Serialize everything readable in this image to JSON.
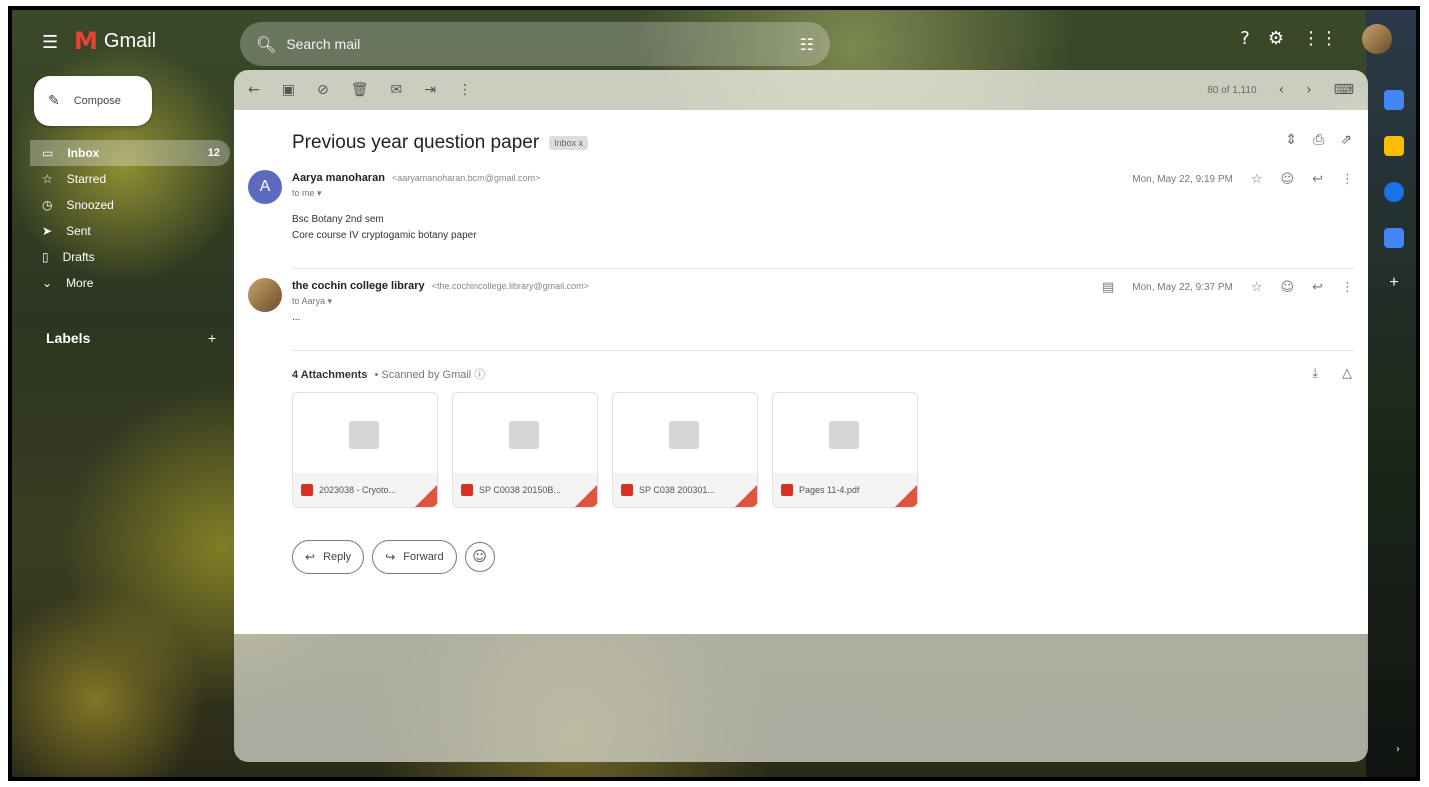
{
  "header": {
    "app_name": "Gmail",
    "search_placeholder": "Search mail"
  },
  "sidebar": {
    "compose_label": "Compose",
    "items": [
      {
        "label": "Inbox",
        "count": "12",
        "icon": "inbox-icon"
      },
      {
        "label": "Starred",
        "icon": "star-icon"
      },
      {
        "label": "Snoozed",
        "icon": "clock-icon"
      },
      {
        "label": "Sent",
        "icon": "send-icon"
      },
      {
        "label": "Drafts",
        "icon": "draft-icon"
      },
      {
        "label": "More",
        "icon": "chevron-down-icon"
      }
    ],
    "labels_title": "Labels",
    "labels_add": "+"
  },
  "toolbar": {
    "range": "80 of 1,110"
  },
  "thread": {
    "subject": "Previous year question paper",
    "label_chip": "Inbox x",
    "messages": [
      {
        "avatar_letter": "A",
        "sender_name": "Aarya manoharan",
        "sender_email": "<aaryamanoharan.bcm@gmail.com>",
        "to": "to me",
        "body_lines": [
          "Bsc Botany 2nd sem",
          "Core course IV cryptogamic botany paper"
        ],
        "date": "Mon, May 22, 9:19 PM"
      },
      {
        "sender_name": "the cochin college library",
        "sender_email": "<the.cochincollege.library@gmail.com>",
        "to": "to Aarya",
        "body_lines": [
          "..."
        ],
        "date": "Mon, May 22, 9:37 PM"
      }
    ],
    "attachments_label": "4 Attachments",
    "scanned_label": "• Scanned by Gmail ⓘ",
    "attachments": [
      {
        "name": "2023038 - Cryoto..."
      },
      {
        "name": "SP C0038 20150B..."
      },
      {
        "name": "SP C038 200301..."
      },
      {
        "name": "Pages 11-4.pdf"
      }
    ],
    "reply_label": "Reply",
    "forward_label": "Forward"
  }
}
